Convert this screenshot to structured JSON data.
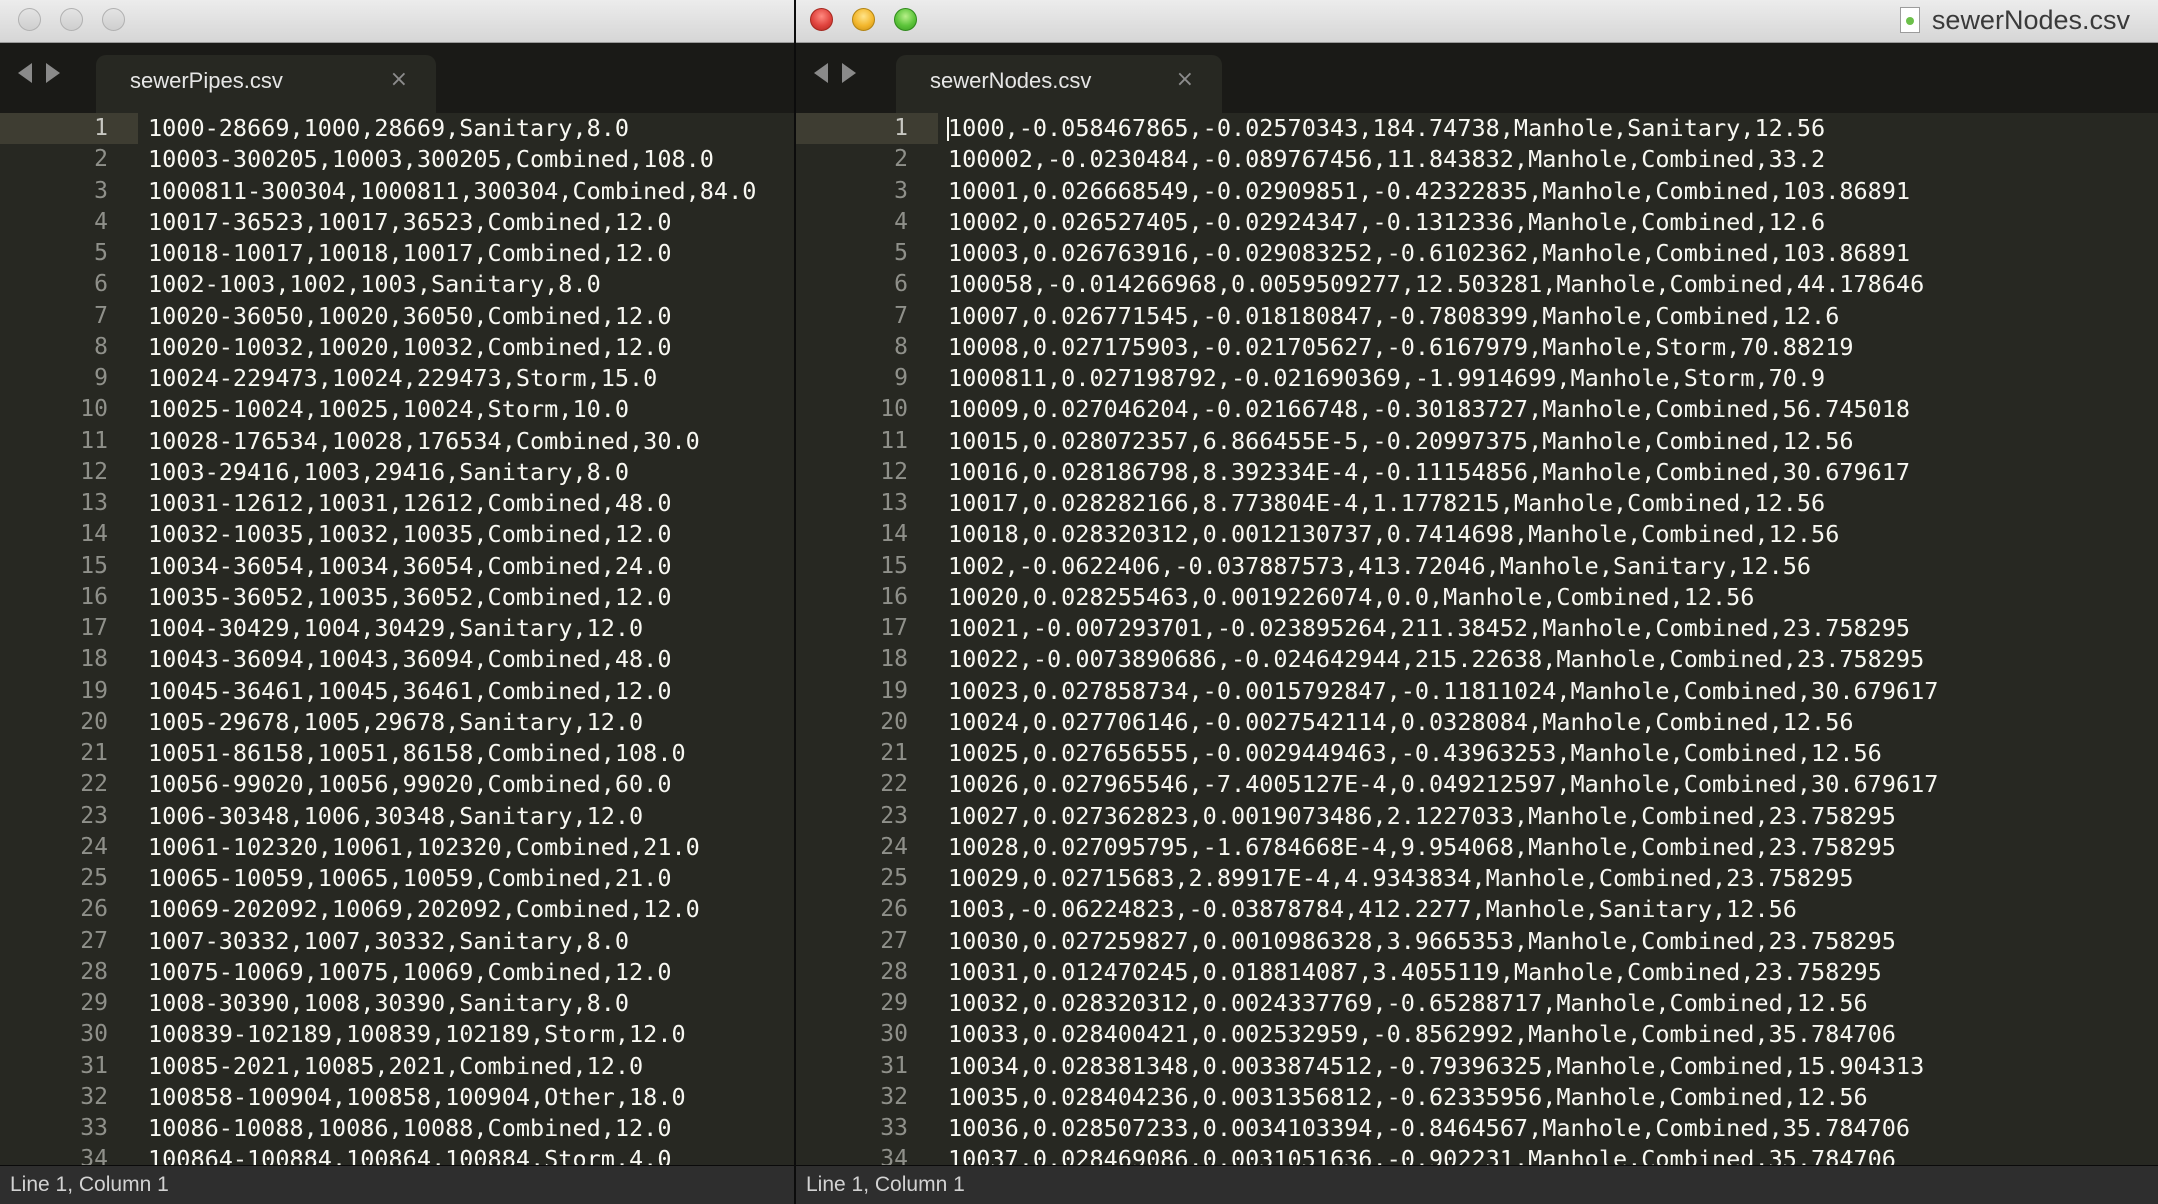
{
  "left": {
    "tab_label": "sewerPipes.csv",
    "close_glyph": "×",
    "status": "Line 1, Column 1",
    "line_numbers": [
      "1",
      "2",
      "3",
      "4",
      "5",
      "6",
      "7",
      "8",
      "9",
      "10",
      "11",
      "12",
      "13",
      "14",
      "15",
      "16",
      "17",
      "18",
      "19",
      "20",
      "21",
      "22",
      "23",
      "24",
      "25",
      "26",
      "27",
      "28",
      "29",
      "30",
      "31",
      "32",
      "33",
      "34"
    ],
    "lines": [
      "1000-28669,1000,28669,Sanitary,8.0",
      "10003-300205,10003,300205,Combined,108.0",
      "1000811-300304,1000811,300304,Combined,84.0",
      "10017-36523,10017,36523,Combined,12.0",
      "10018-10017,10018,10017,Combined,12.0",
      "1002-1003,1002,1003,Sanitary,8.0",
      "10020-36050,10020,36050,Combined,12.0",
      "10020-10032,10020,10032,Combined,12.0",
      "10024-229473,10024,229473,Storm,15.0",
      "10025-10024,10025,10024,Storm,10.0",
      "10028-176534,10028,176534,Combined,30.0",
      "1003-29416,1003,29416,Sanitary,8.0",
      "10031-12612,10031,12612,Combined,48.0",
      "10032-10035,10032,10035,Combined,12.0",
      "10034-36054,10034,36054,Combined,24.0",
      "10035-36052,10035,36052,Combined,12.0",
      "1004-30429,1004,30429,Sanitary,12.0",
      "10043-36094,10043,36094,Combined,48.0",
      "10045-36461,10045,36461,Combined,12.0",
      "1005-29678,1005,29678,Sanitary,12.0",
      "10051-86158,10051,86158,Combined,108.0",
      "10056-99020,10056,99020,Combined,60.0",
      "1006-30348,1006,30348,Sanitary,12.0",
      "10061-102320,10061,102320,Combined,21.0",
      "10065-10059,10065,10059,Combined,21.0",
      "10069-202092,10069,202092,Combined,12.0",
      "1007-30332,1007,30332,Sanitary,8.0",
      "10075-10069,10075,10069,Combined,12.0",
      "1008-30390,1008,30390,Sanitary,8.0",
      "100839-102189,100839,102189,Storm,12.0",
      "10085-2021,10085,2021,Combined,12.0",
      "100858-100904,100858,100904,Other,18.0",
      "10086-10088,10086,10088,Combined,12.0",
      "100864-100884,100864,100884,Storm,4.0"
    ]
  },
  "right": {
    "window_title": "sewerNodes.csv",
    "tab_label": "sewerNodes.csv",
    "close_glyph": "×",
    "status": "Line 1, Column 1",
    "line_numbers": [
      "1",
      "2",
      "3",
      "4",
      "5",
      "6",
      "7",
      "8",
      "9",
      "10",
      "11",
      "12",
      "13",
      "14",
      "15",
      "16",
      "17",
      "18",
      "19",
      "20",
      "21",
      "22",
      "23",
      "24",
      "25",
      "26",
      "27",
      "28",
      "29",
      "30",
      "31",
      "32",
      "33",
      "34"
    ],
    "lines": [
      "1000,-0.058467865,-0.02570343,184.74738,Manhole,Sanitary,12.56",
      "100002,-0.0230484,-0.089767456,11.843832,Manhole,Combined,33.2",
      "10001,0.026668549,-0.02909851,-0.42322835,Manhole,Combined,103.86891",
      "10002,0.026527405,-0.02924347,-0.1312336,Manhole,Combined,12.6",
      "10003,0.026763916,-0.029083252,-0.6102362,Manhole,Combined,103.86891",
      "100058,-0.014266968,0.0059509277,12.503281,Manhole,Combined,44.178646",
      "10007,0.026771545,-0.018180847,-0.7808399,Manhole,Combined,12.6",
      "10008,0.027175903,-0.021705627,-0.6167979,Manhole,Storm,70.88219",
      "1000811,0.027198792,-0.021690369,-1.9914699,Manhole,Storm,70.9",
      "10009,0.027046204,-0.02166748,-0.30183727,Manhole,Combined,56.745018",
      "10015,0.028072357,6.866455E-5,-0.20997375,Manhole,Combined,12.56",
      "10016,0.028186798,8.392334E-4,-0.11154856,Manhole,Combined,30.679617",
      "10017,0.028282166,8.773804E-4,1.1778215,Manhole,Combined,12.56",
      "10018,0.028320312,0.0012130737,0.7414698,Manhole,Combined,12.56",
      "1002,-0.0622406,-0.037887573,413.72046,Manhole,Sanitary,12.56",
      "10020,0.028255463,0.0019226074,0.0,Manhole,Combined,12.56",
      "10021,-0.007293701,-0.023895264,211.38452,Manhole,Combined,23.758295",
      "10022,-0.0073890686,-0.024642944,215.22638,Manhole,Combined,23.758295",
      "10023,0.027858734,-0.0015792847,-0.11811024,Manhole,Combined,30.679617",
      "10024,0.027706146,-0.0027542114,0.0328084,Manhole,Combined,12.56",
      "10025,0.027656555,-0.0029449463,-0.43963253,Manhole,Combined,12.56",
      "10026,0.027965546,-7.4005127E-4,0.049212597,Manhole,Combined,30.679617",
      "10027,0.027362823,0.0019073486,2.1227033,Manhole,Combined,23.758295",
      "10028,0.027095795,-1.6784668E-4,9.954068,Manhole,Combined,23.758295",
      "10029,0.02715683,2.89917E-4,4.9343834,Manhole,Combined,23.758295",
      "1003,-0.06224823,-0.03878784,412.2277,Manhole,Sanitary,12.56",
      "10030,0.027259827,0.0010986328,3.9665353,Manhole,Combined,23.758295",
      "10031,0.012470245,0.018814087,3.4055119,Manhole,Combined,23.758295",
      "10032,0.028320312,0.0024337769,-0.65288717,Manhole,Combined,12.56",
      "10033,0.028400421,0.002532959,-0.8562992,Manhole,Combined,35.784706",
      "10034,0.028381348,0.0033874512,-0.79396325,Manhole,Combined,15.904313",
      "10035,0.028404236,0.0031356812,-0.62335956,Manhole,Combined,12.56",
      "10036,0.028507233,0.0034103394,-0.8464567,Manhole,Combined,35.784706",
      "10037,0.028469086,0.0031051636,-0.902231,Manhole,Combined,35.784706"
    ]
  }
}
